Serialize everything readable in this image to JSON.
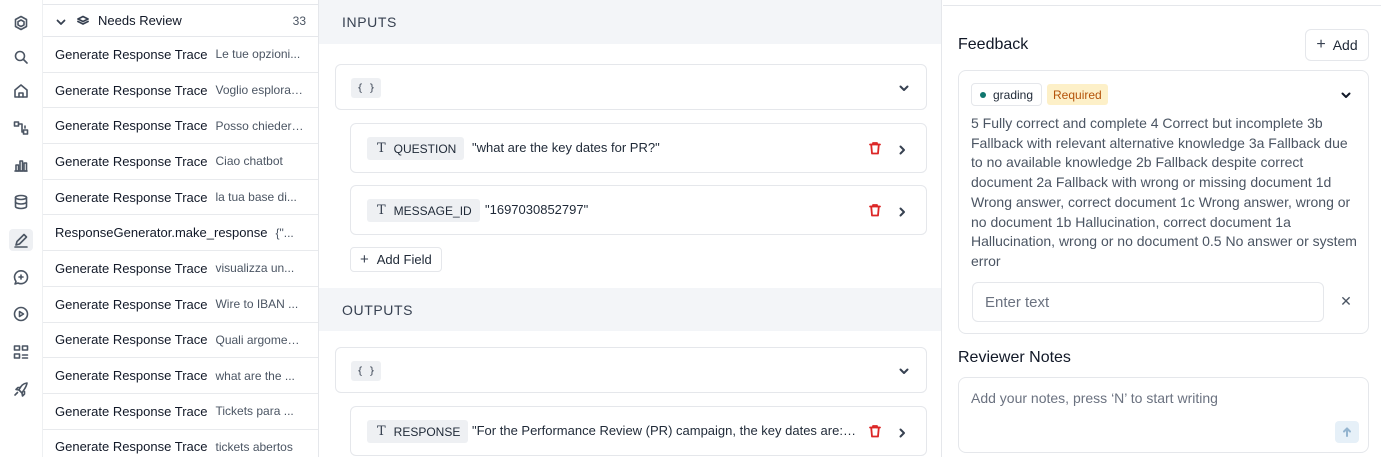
{
  "rail": {
    "icons": [
      "logo-icon",
      "search-icon",
      "home-icon",
      "workflow-icon",
      "chart-icon",
      "database-icon",
      "annotate-icon",
      "chat-icon",
      "play-icon",
      "dashboard-icon",
      "rocket-icon"
    ],
    "active": "annotate-icon"
  },
  "queue": {
    "title": "Needs Review",
    "count": "33",
    "rows": [
      {
        "name": "Generate Response Trace",
        "preview": "Le tue opzioni..."
      },
      {
        "name": "Generate Response Trace",
        "preview": "Voglio esplorare..."
      },
      {
        "name": "Generate Response Trace",
        "preview": "Posso chiedere..."
      },
      {
        "name": "Generate Response Trace",
        "preview": "Ciao chatbot"
      },
      {
        "name": "Generate Response Trace",
        "preview": "la tua base di..."
      },
      {
        "name": "ResponseGenerator.make_response",
        "preview": "{\"..."
      },
      {
        "name": "Generate Response Trace",
        "preview": "visualizza un..."
      },
      {
        "name": "Generate Response Trace",
        "preview": "Wire to IBAN ..."
      },
      {
        "name": "Generate Response Trace",
        "preview": "Quali argomenti..."
      },
      {
        "name": "Generate Response Trace",
        "preview": "what are the ..."
      },
      {
        "name": "Generate Response Trace",
        "preview": "Tickets para ..."
      },
      {
        "name": "Generate Response Trace",
        "preview": "tickets abertos"
      }
    ]
  },
  "inputs": {
    "header": "INPUTS",
    "json_tag": "{ }",
    "fields": [
      {
        "key": "QUESTION",
        "value": "\"what are the key dates for PR?\""
      },
      {
        "key": "MESSAGE_ID",
        "value": "\"1697030852797\""
      }
    ],
    "add_field_label": "Add Field"
  },
  "outputs": {
    "header": "OUTPUTS",
    "json_tag": "{ }",
    "fields": [
      {
        "key": "RESPONSE",
        "value": "\"For the Performance Review (PR) campaign, the key dates are:\\..."
      }
    ]
  },
  "feedback": {
    "title": "Feedback",
    "add_label": "Add",
    "tag": "grading",
    "required_label": "Required",
    "description": "5 Fully correct and complete 4 Correct but incomplete 3b Fallback with relevant alternative knowledge 3a Fallback due to no available knowledge 2b Fallback despite correct document 2a Fallback with wrong or missing document 1d Wrong answer, correct document 1c Wrong answer, wrong or no document 1b Hallucination, correct document 1a Hallucination, wrong or no document 0.5 No answer or system error",
    "input_placeholder": "Enter text",
    "clear_glyph": "✕"
  },
  "notes": {
    "title": "Reviewer Notes",
    "placeholder": "Add your notes, press ‘N’ to start writing"
  },
  "colors": {
    "required_bg": "#fdf0c8",
    "required_text": "#b45309",
    "delete_red": "#dc2626",
    "grading_dot": "#0f766e"
  }
}
